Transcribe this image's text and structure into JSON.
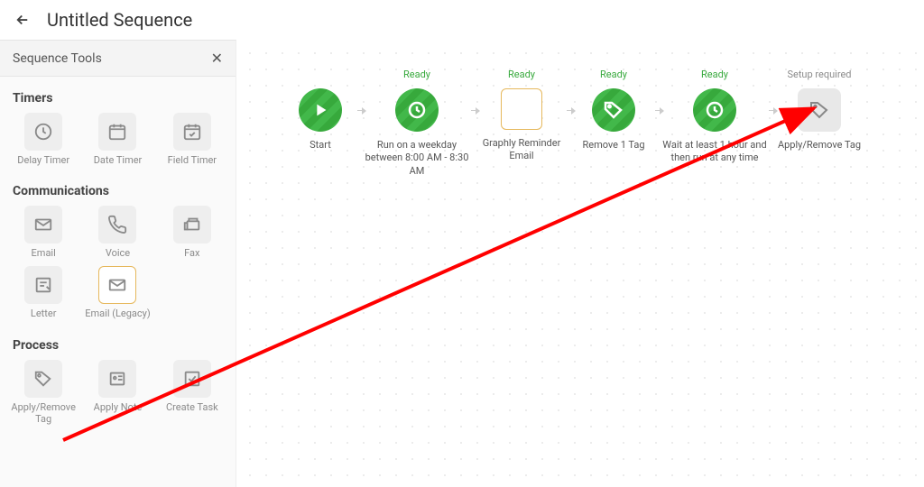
{
  "header": {
    "title": "Untitled Sequence"
  },
  "sidebar": {
    "title": "Sequence Tools",
    "sections": {
      "timers": {
        "title": "Timers",
        "items": [
          "Delay Timer",
          "Date Timer",
          "Field Timer"
        ]
      },
      "communications": {
        "title": "Communications",
        "items": [
          "Email",
          "Voice",
          "Fax",
          "Letter",
          "Email (Legacy)"
        ]
      },
      "process": {
        "title": "Process",
        "items": [
          "Apply/Remove Tag",
          "Apply Note",
          "Create Task"
        ]
      }
    }
  },
  "flow": {
    "statuses": {
      "ready": "Ready",
      "setup": "Setup required"
    },
    "nodes": [
      {
        "label": "Start"
      },
      {
        "label": "Run on a weekday between 8:00 AM - 8:30 AM"
      },
      {
        "label": "Graphly Reminder Email"
      },
      {
        "label": "Remove 1 Tag"
      },
      {
        "label": "Wait at least 1 hour and then run at any time"
      },
      {
        "label": "Apply/Remove Tag"
      }
    ]
  },
  "annotation": {
    "color": "#ff0000"
  }
}
